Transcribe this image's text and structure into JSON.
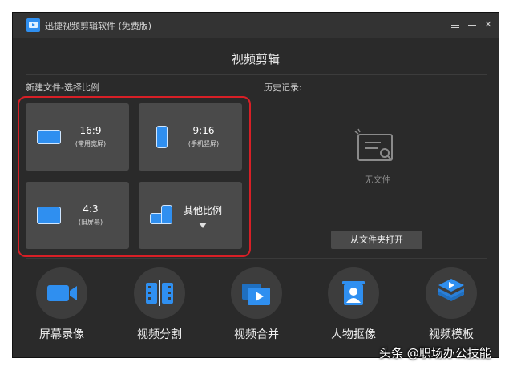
{
  "app": {
    "title": "迅捷视频剪辑软件 (免费版)"
  },
  "section": {
    "title": "视频剪辑"
  },
  "new_file": {
    "label": "新建文件-选择比例",
    "ratios": [
      {
        "main": "16:9",
        "sub": "(常用宽屏)"
      },
      {
        "main": "9:16",
        "sub": "(手机竖屏)"
      },
      {
        "main": "4:3",
        "sub": "(旧屏幕)"
      },
      {
        "main": "其他比例",
        "sub": ""
      }
    ]
  },
  "history": {
    "label": "历史记录:",
    "empty_text": "无文件",
    "open_button": "从文件夹打开"
  },
  "tools": [
    {
      "label": "屏幕录像",
      "icon": "camera-icon"
    },
    {
      "label": "视频分割",
      "icon": "film-split-icon"
    },
    {
      "label": "视频合并",
      "icon": "merge-play-icon"
    },
    {
      "label": "人物抠像",
      "icon": "portrait-icon"
    },
    {
      "label": "视频模板",
      "icon": "layers-play-icon"
    }
  ],
  "watermark": "头条 @职场办公技能",
  "colors": {
    "accent": "#2f8ff0",
    "highlight_border": "#d81f26",
    "window_bg": "#2a2a2a"
  }
}
